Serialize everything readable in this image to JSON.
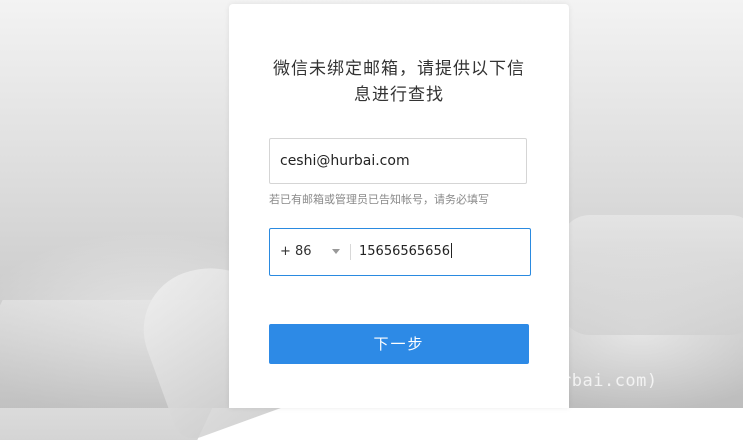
{
  "dialog": {
    "title_line1": "微信未绑定邮箱，请提供以下信",
    "title_line2": "息进行查找",
    "email": {
      "value": "ceshi@hurbai.com"
    },
    "hint": "若已有邮箱或管理员已告知帐号，请务必填写",
    "phone": {
      "country_code": "+ 86",
      "value": "15656565656"
    },
    "next_button": "下一步"
  },
  "watermark": "@大灰hurbai (www.hurbai.com)",
  "colors": {
    "accent": "#2d8ae6",
    "focus_border": "#2a8ae0",
    "hint_text": "#8a8a8a"
  }
}
